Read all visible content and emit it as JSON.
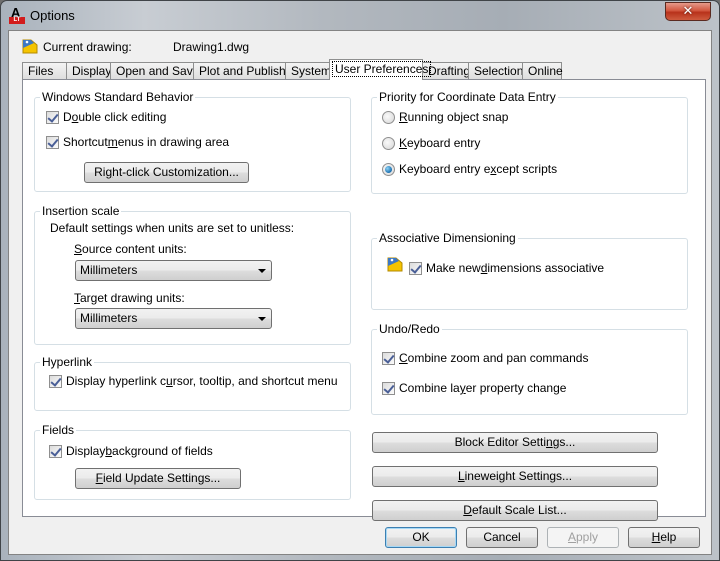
{
  "window": {
    "title": "Options",
    "app_icon": "autocad-lt-icon",
    "close_label": "✕"
  },
  "current_drawing": {
    "label": "Current drawing:",
    "value": "Drawing1.dwg"
  },
  "tabs": [
    {
      "label": "Files",
      "active": false
    },
    {
      "label": "Display",
      "active": false
    },
    {
      "label": "Open and Save",
      "active": false
    },
    {
      "label": "Plot and Publish",
      "active": false
    },
    {
      "label": "System",
      "active": false
    },
    {
      "label": "User Preferences",
      "active": true
    },
    {
      "label": "Drafting",
      "active": false
    },
    {
      "label": "Selection",
      "active": false
    },
    {
      "label": "Online",
      "active": false
    }
  ],
  "windows_standard_behavior": {
    "title": "Windows Standard Behavior",
    "double_click": {
      "pre": "D",
      "ul": "o",
      "post": "uble click editing",
      "checked": true
    },
    "shortcut_menus": {
      "pre": "Shortcut ",
      "ul": "m",
      "post": "enus in drawing area",
      "checked": true
    },
    "right_click_button": {
      "pre": "Ri",
      "ul": "g",
      "post": "ht-click Customization..."
    }
  },
  "insertion_scale": {
    "title": "Insertion scale",
    "description": "Default settings when units are set to unitless:",
    "source_label": {
      "ul": "S",
      "post": "ource content units:"
    },
    "source_value": "Millimeters",
    "target_label": {
      "ul": "T",
      "post": "arget drawing units:"
    },
    "target_value": "Millimeters"
  },
  "hyperlink": {
    "title": "Hyperlink",
    "display": {
      "pre": "Display hyperlink c",
      "ul": "u",
      "post": "rsor, tooltip, and shortcut menu",
      "checked": true
    }
  },
  "fields": {
    "title": "Fields",
    "display_background": {
      "pre": "Display ",
      "ul": "b",
      "post": "ackground of fields",
      "checked": true
    },
    "update_button": {
      "pre": "",
      "ul": "F",
      "post": "ield Update Settings..."
    }
  },
  "coordinate_priority": {
    "title": "Priority for Coordinate Data Entry",
    "options": [
      {
        "pre": "",
        "ul": "R",
        "post": "unning object snap",
        "selected": false
      },
      {
        "pre": "",
        "ul": "K",
        "post": "eyboard entry",
        "selected": false
      },
      {
        "pre": "Keyboard entry e",
        "ul": "x",
        "post": "cept scripts",
        "selected": true
      }
    ]
  },
  "associative_dimensioning": {
    "title": "Associative Dimensioning",
    "make_associative": {
      "pre": "Make new ",
      "ul": "d",
      "post": "imensions associative",
      "checked": true
    }
  },
  "undo_redo": {
    "title": "Undo/Redo",
    "combine_zoom": {
      "pre": "",
      "ul": "C",
      "post": "ombine zoom and pan commands",
      "checked": true
    },
    "combine_layer": {
      "pre": "Combine la",
      "ul": "y",
      "post": "er property change",
      "checked": true
    }
  },
  "right_buttons": {
    "block_editor": {
      "pre": "Block Editor Setti",
      "ul": "n",
      "post": "gs..."
    },
    "lineweight": {
      "pre": "",
      "ul": "L",
      "post": "ineweight Settings..."
    },
    "scale_list": {
      "pre": "",
      "ul": "D",
      "post": "efault Scale List..."
    }
  },
  "footer": {
    "ok": "OK",
    "cancel": "Cancel",
    "apply": {
      "pre": "",
      "ul": "A",
      "post": "pply",
      "enabled": false
    },
    "help": {
      "pre": "",
      "ul": "H",
      "post": "elp"
    }
  }
}
